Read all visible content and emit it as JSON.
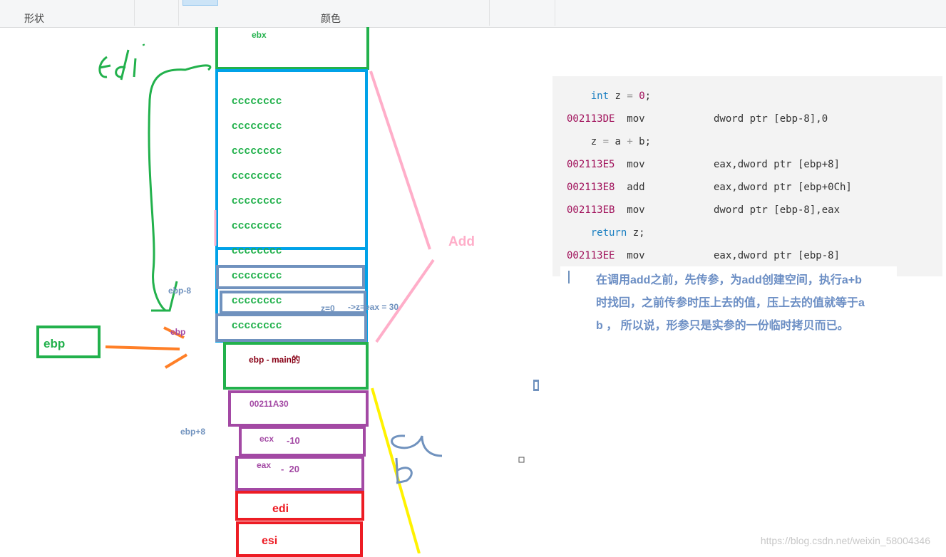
{
  "ribbon": {
    "shapes_label": "形状",
    "colors_label": "颜色"
  },
  "stack": {
    "ebx": "ebx",
    "fill_rows": [
      "cccccccc",
      "cccccccc",
      "cccccccc",
      "cccccccc",
      "cccccccc",
      "cccccccc",
      "cccccccc",
      "cccccccc",
      "cccccccc",
      "cccccccc"
    ],
    "ebp_main": "ebp - main的",
    "ret_addr": "00211A30",
    "ecx": "ecx",
    "ecx_val": "-10",
    "eax": "eax",
    "eax_val": "-  20",
    "edi": "edi",
    "esi": "esi"
  },
  "annotations": {
    "edi_hand": "edi",
    "ebp_minus_8": "ebp-8",
    "ebp_small": "ebp",
    "ebp_box": "ebp",
    "ebp_plus_8": "ebp+8",
    "z_zero": "z=0",
    "z_eax": "->z=eax = 30",
    "add": "Add",
    "a_hand": "a",
    "b_hand": "b"
  },
  "code": [
    {
      "addr": "",
      "op": "",
      "src": "    int z = 0;"
    },
    {
      "addr": "002113DE",
      "op": "mov",
      "src": "dword ptr [ebp-8],0"
    },
    {
      "addr": "",
      "op": "",
      "src": "    z = a + b;"
    },
    {
      "addr": "002113E5",
      "op": "mov",
      "src": "eax,dword ptr [ebp+8]"
    },
    {
      "addr": "002113E8",
      "op": "add",
      "src": "eax,dword ptr [ebp+0Ch]"
    },
    {
      "addr": "002113EB",
      "op": "mov",
      "src": "dword ptr [ebp-8],eax"
    },
    {
      "addr": "",
      "op": "",
      "src": "    return z;"
    },
    {
      "addr": "002113EE",
      "op": "mov",
      "src": "eax,dword ptr [ebp-8]"
    }
  ],
  "note": "在调用add之前，先传参，为add创建空间，执行a+b时找回，之前传参时压上去的值，压上去的值就等于a b ， 所以说，形参只是实参的一份临时拷贝而已。",
  "watermark": "https://blog.csdn.net/weixin_58004346",
  "colors": {
    "green": "#22b14c",
    "blue": "#00a2e8",
    "slate": "#7092be",
    "purple": "#a349a4",
    "red": "#ed1c24",
    "pink": "#ffaec9",
    "orange": "#ff7f27",
    "yellow": "#fff200"
  }
}
